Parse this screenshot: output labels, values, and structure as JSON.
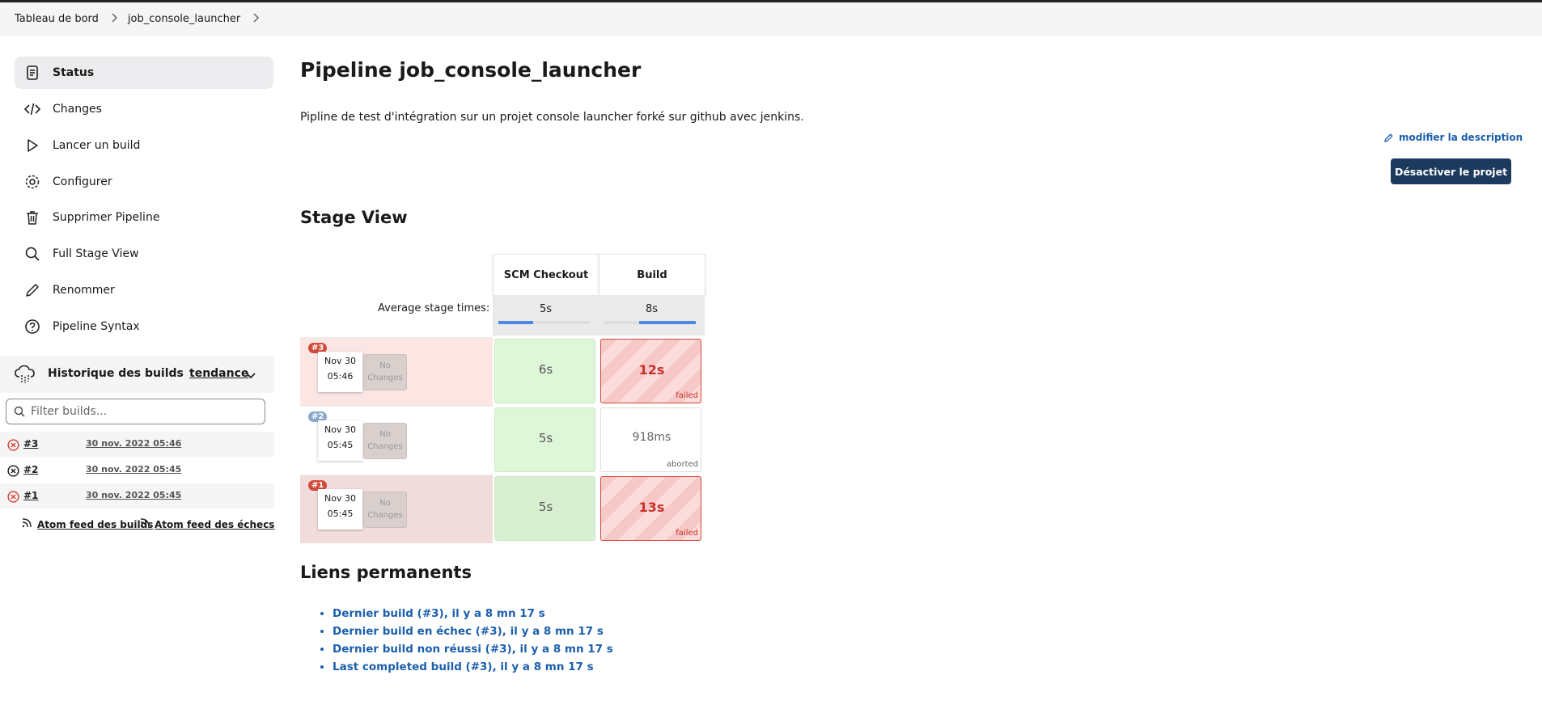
{
  "breadcrumb": {
    "items": [
      "Tableau de bord",
      "job_console_launcher"
    ]
  },
  "sidebar": {
    "items": [
      {
        "label": "Status",
        "icon": "status-icon"
      },
      {
        "label": "Changes",
        "icon": "code-icon"
      },
      {
        "label": "Lancer un build",
        "icon": "play-icon"
      },
      {
        "label": "Configurer",
        "icon": "gear-icon"
      },
      {
        "label": "Supprimer Pipeline",
        "icon": "trash-icon"
      },
      {
        "label": "Full Stage View",
        "icon": "search-icon"
      },
      {
        "label": "Renommer",
        "icon": "pencil-icon"
      },
      {
        "label": "Pipeline Syntax",
        "icon": "help-icon"
      }
    ]
  },
  "history": {
    "title": "Historique des builds",
    "trend_label": "tendance",
    "filter_placeholder": "Filter builds...",
    "builds": [
      {
        "number": "#3",
        "date": "30 nov. 2022 05:46",
        "status": "failed"
      },
      {
        "number": "#2",
        "date": "30 nov. 2022 05:45",
        "status": "aborted"
      },
      {
        "number": "#1",
        "date": "30 nov. 2022 05:45",
        "status": "failed"
      }
    ],
    "feed_all": "Atom feed des builds",
    "feed_failures": "Atom feed des échecs"
  },
  "page": {
    "title": "Pipeline job_console_launcher",
    "description": "Pipline de test d'intégration sur un projet console launcher forké sur github avec jenkins.",
    "edit_description": "modifier la description",
    "disable_button": "Désactiver le projet"
  },
  "stage_view": {
    "title": "Stage View",
    "avg_label": "Average stage times:",
    "stages": [
      {
        "name": "SCM Checkout",
        "avg": "5s",
        "avg_fraction": 0.38
      },
      {
        "name": "Build",
        "avg": "8s",
        "avg_fraction": 0.62
      }
    ],
    "no_changes": "No Changes",
    "runs": [
      {
        "badge": "#3",
        "date": "Nov 30",
        "time": "05:46",
        "row_status": "failed",
        "cells": [
          {
            "value": "6s",
            "status": "success",
            "tag": ""
          },
          {
            "value": "12s",
            "status": "failed",
            "tag": "failed"
          }
        ]
      },
      {
        "badge": "#2",
        "date": "Nov 30",
        "time": "05:45",
        "row_status": "aborted",
        "cells": [
          {
            "value": "5s",
            "status": "success",
            "tag": ""
          },
          {
            "value": "918ms",
            "status": "aborted",
            "tag": "aborted"
          }
        ]
      },
      {
        "badge": "#1",
        "date": "Nov 30",
        "time": "05:45",
        "row_status": "failed",
        "cells": [
          {
            "value": "5s",
            "status": "success",
            "tag": ""
          },
          {
            "value": "13s",
            "status": "failed",
            "tag": "failed"
          }
        ]
      }
    ]
  },
  "permalinks": {
    "title": "Liens permanents",
    "items": [
      "Dernier build (#3), il y a 8 mn 17 s",
      "Dernier build en échec (#3), il y a 8 mn 17 s",
      "Dernier build non réussi (#3), il y a 8 mn 17 s",
      "Last completed build (#3), il y a 8 mn 17 s"
    ]
  },
  "colors": {
    "primary_button": "#1c3a5e",
    "link": "#1b5fad",
    "failed_red": "#d24939",
    "success_green": "#dff7d9",
    "aborted_blue": "#8aa9c9"
  }
}
